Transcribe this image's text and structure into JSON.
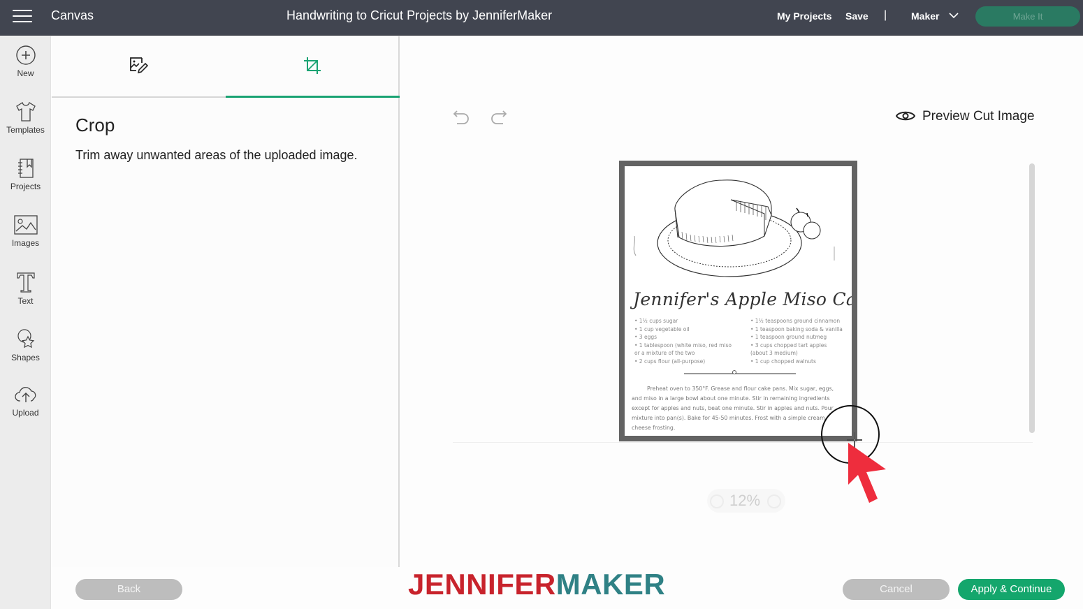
{
  "header": {
    "app_title": "Canvas",
    "doc_title": "Handwriting to Cricut Projects by JenniferMaker",
    "my_projects": "My Projects",
    "save": "Save",
    "separator": "|",
    "machine": "Maker",
    "make_it": "Make It"
  },
  "sidebar": {
    "items": [
      {
        "label": "New",
        "icon": "plus-circle-icon"
      },
      {
        "label": "Templates",
        "icon": "tshirt-icon"
      },
      {
        "label": "Projects",
        "icon": "notebook-icon"
      },
      {
        "label": "Images",
        "icon": "image-icon"
      },
      {
        "label": "Text",
        "icon": "text-icon"
      },
      {
        "label": "Shapes",
        "icon": "shapes-icon"
      },
      {
        "label": "Upload",
        "icon": "upload-cloud-icon"
      }
    ]
  },
  "panel": {
    "tabs": [
      {
        "name": "edit-image",
        "icon": "image-edit-icon",
        "active": false
      },
      {
        "name": "crop",
        "icon": "crop-icon",
        "active": true
      }
    ],
    "title": "Crop",
    "description": "Trim away unwanted areas of the uploaded image."
  },
  "canvas": {
    "preview_label": "Preview Cut Image",
    "zoom_level": "12%",
    "image": {
      "title": "Jennifer's Apple Miso Cake",
      "ingredients_left": [
        "• 1½ cups sugar",
        "• 1 cup vegetable oil",
        "• 3 eggs",
        "• 1 tablespoon (white miso, red miso",
        "   or a mixture of the two",
        "• 2 cups flour (all-purpose)"
      ],
      "ingredients_right": [
        "• 1½ teaspoons ground cinnamon",
        "• 1 teaspoon baking soda & vanilla",
        "• 1 teaspoon ground nutmeg",
        "• 3 cups chopped tart apples",
        "   (about 3 medium)",
        "• 1 cup chopped walnuts"
      ],
      "method": "Preheat oven to 350°F. Grease and flour cake pans. Mix sugar, eggs, and miso in a large bowl about one minute. Stir in remaining ingredients except for apples and nuts, beat one minute. Stir in apples and nuts. Pour mixture into pan(s). Bake for 45-50 minutes. Frost with a simple cream cheese frosting."
    }
  },
  "footer": {
    "back": "Back",
    "cancel": "Cancel",
    "apply": "Apply & Continue",
    "logo_part1": "JENNIFER",
    "logo_part2": "MAKER"
  },
  "colors": {
    "topbar": "#414550",
    "accent_green": "#14a66c",
    "logo_red": "#c8232c",
    "logo_teal": "#2f8185"
  }
}
